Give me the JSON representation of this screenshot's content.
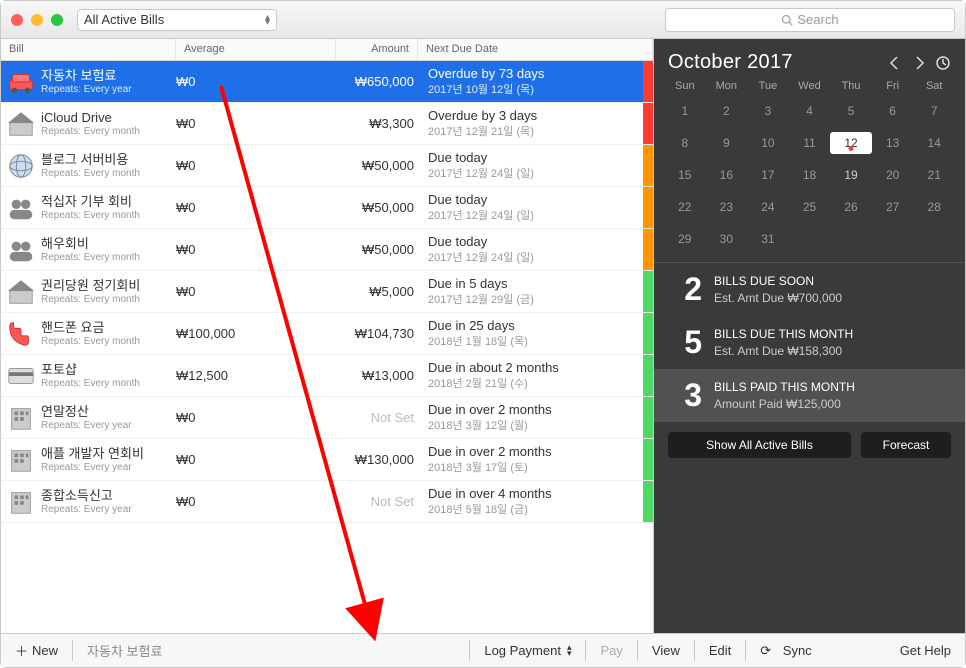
{
  "toolbar": {
    "filter_dropdown": "All Active Bills",
    "search_placeholder": "Search"
  },
  "columns": {
    "bill": "Bill",
    "avg": "Average",
    "amt": "Amount",
    "due": "Next Due Date"
  },
  "bills": [
    {
      "icon": "car",
      "name": "자동차 보험료",
      "repeat": "Repeats: Every year",
      "avg": "₩0",
      "amt": "₩650,000",
      "due_top": "Overdue by 73 days",
      "due_sec": "2017년 10월 12일 (목)",
      "tag": "#ff3b30",
      "selected": true
    },
    {
      "icon": "house",
      "name": "iCloud Drive",
      "repeat": "Repeats: Every month",
      "avg": "₩0",
      "amt": "₩3,300",
      "due_top": "Overdue by 3 days",
      "due_sec": "2017년 12월 21일 (목)",
      "tag": "#ff3b30"
    },
    {
      "icon": "globe",
      "name": "블로그 서버비용",
      "repeat": "Repeats: Every month",
      "avg": "₩0",
      "amt": "₩50,000",
      "due_top": "Due today",
      "due_sec": "2017년 12월 24일 (일)",
      "tag": "#ff9500"
    },
    {
      "icon": "group",
      "name": "적십자 기부 회비",
      "repeat": "Repeats: Every month",
      "avg": "₩0",
      "amt": "₩50,000",
      "due_top": "Due today",
      "due_sec": "2017년 12월 24일 (일)",
      "tag": "#ff9500"
    },
    {
      "icon": "group",
      "name": "해우회비",
      "repeat": "Repeats: Every month",
      "avg": "₩0",
      "amt": "₩50,000",
      "due_top": "Due today",
      "due_sec": "2017년 12월 24일 (일)",
      "tag": "#ff9500"
    },
    {
      "icon": "house",
      "name": "권리당원 정기회비",
      "repeat": "Repeats: Every month",
      "avg": "₩0",
      "amt": "₩5,000",
      "due_top": "Due in 5 days",
      "due_sec": "2017년 12월 29일 (금)",
      "tag": "#4cd964"
    },
    {
      "icon": "phone",
      "name": "핸드폰 요금",
      "repeat": "Repeats: Every month",
      "avg": "₩100,000",
      "amt": "₩104,730",
      "due_top": "Due in 25 days",
      "due_sec": "2018년 1월 18일 (목)",
      "tag": "#4cd964"
    },
    {
      "icon": "card",
      "name": "포토샵",
      "repeat": "Repeats: Every month",
      "avg": "₩12,500",
      "amt": "₩13,000",
      "due_top": "Due in about 2 months",
      "due_sec": "2018년 2월 21일 (수)",
      "tag": "#4cd964"
    },
    {
      "icon": "building",
      "name": "연말정산",
      "repeat": "Repeats: Every year",
      "avg": "₩0",
      "amt": "Not Set",
      "due_top": "Due in over 2 months",
      "due_sec": "2018년 3월 12일 (월)",
      "tag": "#4cd964",
      "notset": true
    },
    {
      "icon": "building",
      "name": "애플 개발자 연회비",
      "repeat": "Repeats: Every year",
      "avg": "₩0",
      "amt": "₩130,000",
      "due_top": "Due in over 2 months",
      "due_sec": "2018년 3월 17일 (토)",
      "tag": "#4cd964"
    },
    {
      "icon": "building",
      "name": "종합소득신고",
      "repeat": "Repeats: Every year",
      "avg": "₩0",
      "amt": "Not Set",
      "due_top": "Due in over 4 months",
      "due_sec": "2018년 5월 18일 (금)",
      "tag": "#4cd964",
      "notset": true
    }
  ],
  "calendar": {
    "title": "October 2017",
    "dow": [
      "Sun",
      "Mon",
      "Tue",
      "Wed",
      "Thu",
      "Fri",
      "Sat"
    ],
    "days": [
      {
        "n": "1"
      },
      {
        "n": "2"
      },
      {
        "n": "3"
      },
      {
        "n": "4"
      },
      {
        "n": "5"
      },
      {
        "n": "6"
      },
      {
        "n": "7"
      },
      {
        "n": "8"
      },
      {
        "n": "9"
      },
      {
        "n": "10"
      },
      {
        "n": "11"
      },
      {
        "n": "12",
        "today": true
      },
      {
        "n": "13"
      },
      {
        "n": "14"
      },
      {
        "n": "15"
      },
      {
        "n": "16"
      },
      {
        "n": "17"
      },
      {
        "n": "18"
      },
      {
        "n": "19",
        "u": true
      },
      {
        "n": "20"
      },
      {
        "n": "21"
      },
      {
        "n": "22"
      },
      {
        "n": "23"
      },
      {
        "n": "24"
      },
      {
        "n": "25"
      },
      {
        "n": "26"
      },
      {
        "n": "27"
      },
      {
        "n": "28"
      },
      {
        "n": "29"
      },
      {
        "n": "30"
      },
      {
        "n": "31"
      }
    ]
  },
  "summary": [
    {
      "n": "2",
      "t1": "BILLS DUE SOON",
      "t2": "Est. Amt Due  ₩700,000"
    },
    {
      "n": "5",
      "t1": "BILLS DUE THIS MONTH",
      "t2": "Est. Amt Due  ₩158,300"
    },
    {
      "n": "3",
      "t1": "BILLS PAID THIS MONTH",
      "t2": "Amount Paid  ₩125,000",
      "sel": true
    }
  ],
  "sidebar_buttons": {
    "show": "Show All Active Bills",
    "forecast": "Forecast"
  },
  "footer": {
    "new": "New",
    "selected": "자동차 보험료",
    "log": "Log Payment",
    "pay": "Pay",
    "view": "View",
    "edit": "Edit",
    "sync": "Sync",
    "help": "Get Help"
  }
}
